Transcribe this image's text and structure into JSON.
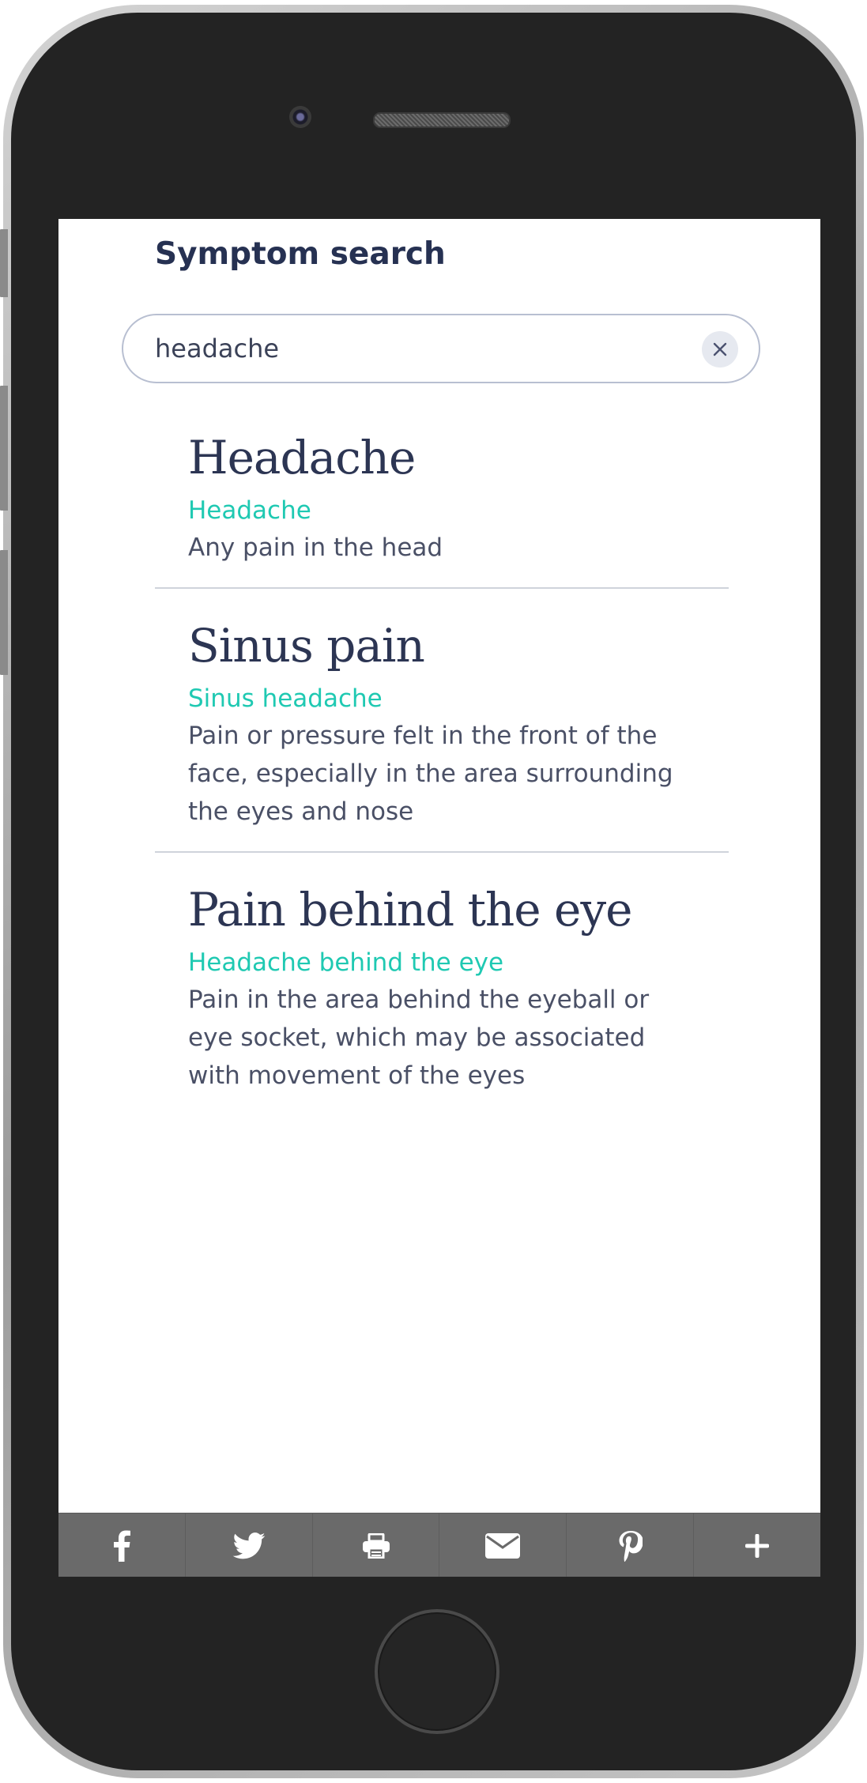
{
  "header": {
    "title": "Symptom search"
  },
  "search": {
    "value": "headache",
    "placeholder": ""
  },
  "results": [
    {
      "title": "Headache",
      "subtitle": "Headache",
      "description": "Any pain in the head"
    },
    {
      "title": "Sinus pain",
      "subtitle": "Sinus headache",
      "description": "Pain or pressure felt in the front of the face, especially in the area surrounding the eyes and nose"
    },
    {
      "title": "Pain behind the eye",
      "subtitle": "Headache behind the eye",
      "description": "Pain in the area behind the eyeball or eye socket, which may be associated with movement of the eyes"
    }
  ],
  "share_bar": {
    "items": [
      "facebook-icon",
      "twitter-icon",
      "print-icon",
      "email-icon",
      "pinterest-icon",
      "plus-icon"
    ],
    "background": "#6a6a6a"
  },
  "colors": {
    "accent": "#1fc9b2",
    "heading": "#263152",
    "text": "#4a5066"
  }
}
